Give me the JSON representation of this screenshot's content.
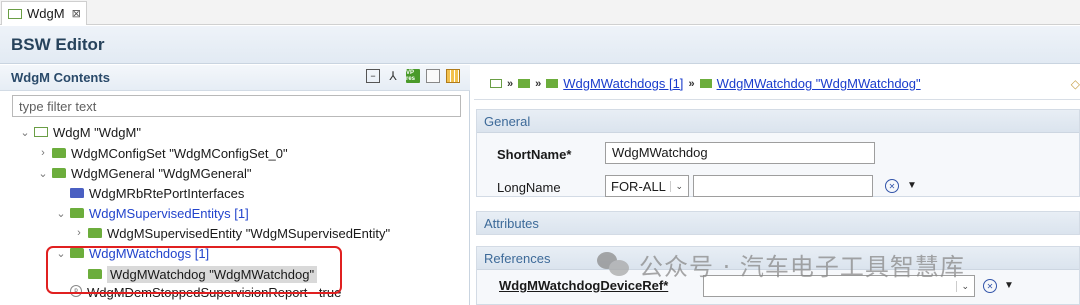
{
  "tab": {
    "label": "WdgM",
    "close": "⊠"
  },
  "editor": {
    "title": "BSW Editor"
  },
  "contents": {
    "title": "WdgM Contents",
    "toolbar": {
      "vp": "VP res"
    },
    "filter": {
      "placeholder": "type filter text",
      "value": ""
    }
  },
  "tree": [
    {
      "label": "WdgM \"WdgM\""
    },
    {
      "label": "WdgMConfigSet \"WdgMConfigSet_0\""
    },
    {
      "label": "WdgMGeneral \"WdgMGeneral\""
    },
    {
      "label": "WdgMRbRtePortInterfaces"
    },
    {
      "label": "WdgMSupervisedEntitys [1]"
    },
    {
      "label": "WdgMSupervisedEntity \"WdgMSupervisedEntity\""
    },
    {
      "label": "WdgMWatchdogs [1]"
    },
    {
      "label": "WdgMWatchdog \"WdgMWatchdog\""
    },
    {
      "label": "WdgMDemStoppedSupervisionReport - true"
    }
  ],
  "breadcrumb": {
    "items": [
      "WdgMWatchdogs [1]",
      "WdgMWatchdog \"WdgMWatchdog\""
    ]
  },
  "general": {
    "title": "General",
    "shortname_label": "ShortName*",
    "shortname_value": "WdgMWatchdog",
    "longname_label": "LongName",
    "longname_lang": "FOR-ALL",
    "longname_value": ""
  },
  "attributes": {
    "title": "Attributes"
  },
  "references": {
    "title": "References",
    "device_ref_label": "WdgMWatchdogDeviceRef*",
    "device_ref_value": ""
  },
  "watermark": {
    "text": "公众号 · 汽车电子工具智慧库"
  }
}
